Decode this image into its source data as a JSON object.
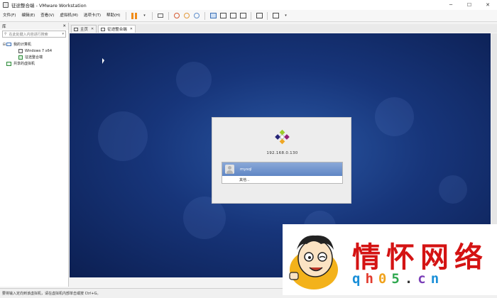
{
  "window": {
    "title": "征途整合端 - VMware Workstation",
    "minimize": "─",
    "maximize": "☐",
    "close": "✕"
  },
  "menu": [
    {
      "label": "文件(F)"
    },
    {
      "label": "编辑(E)"
    },
    {
      "label": "查看(V)"
    },
    {
      "label": "虚拟机(M)"
    },
    {
      "label": "选项卡(T)"
    },
    {
      "label": "帮助(H)"
    }
  ],
  "toolbar": {
    "dropdown_glyph": "▾"
  },
  "library": {
    "title": "库",
    "close": "✕",
    "search_placeholder": "在此处键入内容进行搜索",
    "search_dropdown": "▾",
    "tree": {
      "root": "我的计算机",
      "expand": "⊟",
      "vms": [
        "Windows 7 x64",
        "征途整合端"
      ],
      "shared": "共享的虚拟机"
    }
  },
  "tabs": [
    {
      "label": "主页",
      "close": "✕"
    },
    {
      "label": "征途整合端",
      "close": "✕"
    }
  ],
  "login": {
    "ip": "192.168.0.130",
    "user": "mysql",
    "other": "其他..."
  },
  "statusbar": {
    "text": "要将输入定向到该虚拟机，请在虚拟机内部单击或按 Ctrl+G。"
  },
  "watermark": {
    "title": "情怀网络",
    "domain": [
      "q",
      "h",
      "0",
      "5",
      ".",
      "c",
      "n"
    ]
  },
  "colors": {
    "accent_orange": "#f08c1a",
    "watermark_red": "#d41313",
    "login_highlight": "#5f86c4"
  }
}
